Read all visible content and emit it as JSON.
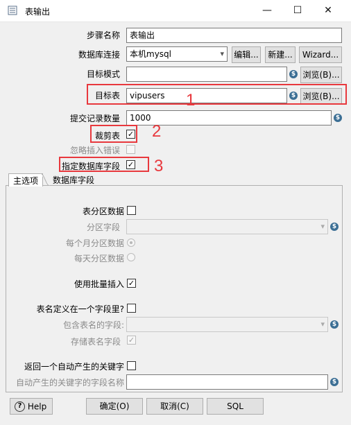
{
  "window": {
    "title": "表输出",
    "minimize_glyph": "—",
    "maximize_glyph": "☐",
    "close_glyph": "✕"
  },
  "form": {
    "step_name": {
      "label": "步骤名称",
      "value": "表输出"
    },
    "db_connection": {
      "label": "数据库连接",
      "value": "本机mysql",
      "edit": "编辑...",
      "new": "新建...",
      "wizard": "Wizard..."
    },
    "target_schema": {
      "label": "目标模式",
      "value": "",
      "browse": "浏览(B)..."
    },
    "target_table": {
      "label": "目标表",
      "value": "vipusers",
      "browse": "浏览(B)..."
    },
    "commit_size": {
      "label": "提交记录数量",
      "value": "1000"
    },
    "truncate_table": {
      "label": "裁剪表",
      "checked": true
    },
    "ignore_insert_errors": {
      "label": "忽略插入错误",
      "checked": false
    },
    "specify_db_fields": {
      "label": "指定数据库字段",
      "checked": true
    }
  },
  "annotations": {
    "one": "1",
    "two": "2",
    "three": "3"
  },
  "tabs": [
    {
      "label": "主选项",
      "active": true
    },
    {
      "label": "数据库字段",
      "active": false
    }
  ],
  "main_options": {
    "partition_data": {
      "label": "表分区数据",
      "checked": false
    },
    "partition_field": {
      "label": "分区字段",
      "value": ""
    },
    "monthly_partition": {
      "label": "每个月分区数据"
    },
    "daily_partition": {
      "label": "每天分区数据"
    },
    "batch_insert": {
      "label": "使用批量插入",
      "checked": true
    },
    "table_name_in_field": {
      "label": "表名定义在一个字段里?",
      "checked": false
    },
    "table_name_field": {
      "label": "包含表名的字段:",
      "value": ""
    },
    "store_table_name_field": {
      "label": "存储表名字段",
      "checked": true
    },
    "return_generated_key": {
      "label": "返回一个自动产生的关键字",
      "checked": false
    },
    "generated_key_field": {
      "label": "自动产生的关键字的字段名称",
      "value": ""
    }
  },
  "buttons": {
    "help": "Help",
    "help_glyph": "?",
    "ok": "确定(O)",
    "cancel": "取消(C)",
    "sql": "SQL"
  },
  "icons": {
    "variable_glyph": "$",
    "check_glyph": "✓",
    "combo_arrow": "▾"
  }
}
